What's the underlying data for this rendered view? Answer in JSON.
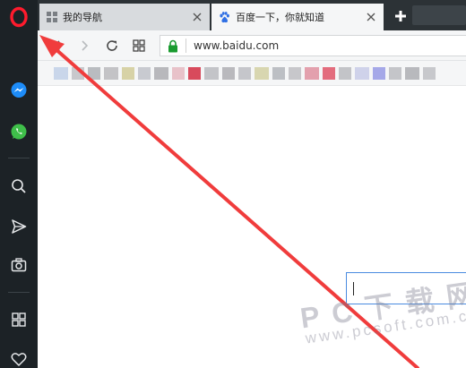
{
  "sidebar": {
    "items": [
      {
        "name": "opera-menu",
        "icon": "opera-logo-icon"
      },
      {
        "name": "messenger",
        "icon": "messenger-icon"
      },
      {
        "name": "whatsapp",
        "icon": "whatsapp-icon"
      },
      {
        "name": "search",
        "icon": "search-icon"
      },
      {
        "name": "send",
        "icon": "send-icon"
      },
      {
        "name": "snapshot",
        "icon": "camera-icon"
      },
      {
        "name": "speed-dial",
        "icon": "grid-icon"
      },
      {
        "name": "bookmarks",
        "icon": "heart-icon"
      }
    ]
  },
  "tabs": [
    {
      "label": "我的导航",
      "icon": "grid-icon",
      "active": false
    },
    {
      "label": "百度一下，你就知道",
      "icon": "baidu-paw-icon",
      "active": true
    }
  ],
  "toolbar": {
    "url": "www.baidu.com",
    "buttons": [
      "back-icon",
      "forward-icon",
      "reload-icon",
      "grid-icon",
      "lock-icon"
    ]
  },
  "bookmarks_bar": {
    "colors": [
      "#c9d6ea",
      "#c8c8cc",
      "#b9bcc0",
      "#c3c3c6",
      "#d7d2a6",
      "#c8cad0",
      "#b8b8bc",
      "#e8c2c9",
      "#d84a5c",
      "#c3c4c8",
      "#b9b9bd",
      "#c5c6cb",
      "#d8d6b0",
      "#bcbfc4",
      "#c7c7cb",
      "#e3a0ad",
      "#e36c7d",
      "#c3c4c8",
      "#cfd2ea",
      "#a5a8e8",
      "#c4c5c9",
      "#b8b9bd",
      "#c7c8cc"
    ]
  },
  "watermark": {
    "main": "PC下载网",
    "sub": "www.pcsoft.com.cn"
  },
  "colors": {
    "sidebar_bg": "#1c2226",
    "opera_red": "#ff1b2d",
    "arrow_red": "#f03c3c",
    "lock_green": "#1a9b30",
    "focus_blue": "#4a8be0"
  }
}
